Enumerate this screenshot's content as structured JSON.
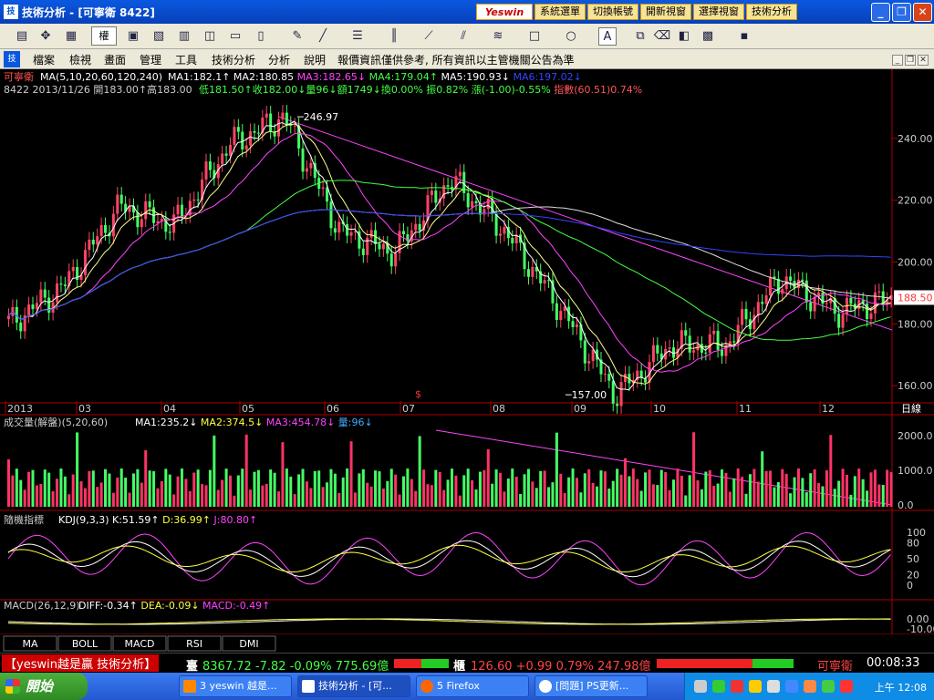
{
  "window": {
    "title": "技術分析 - [可寧衛 8422]",
    "app_icon": "chart-app-icon",
    "top_buttons": [
      "系統選單",
      "切換帳號",
      "開新視窗",
      "選擇視窗",
      "技術分析"
    ],
    "logo": "Yeswin"
  },
  "toolbar": {
    "period_box": "權"
  },
  "menu": {
    "items": [
      "檔案",
      "檢視",
      "畫面",
      "管理",
      "工具",
      "技術分析",
      "分析",
      "說明"
    ],
    "notice": "報價資訊僅供參考, 所有資訊以主管機關公告為準"
  },
  "chart_data": [
    {
      "type": "candlestick",
      "title": "可寧衛",
      "ma_legend": "MA(5,10,20,60,120,240)",
      "ma_values": [
        {
          "label": "MA1:182.1↑",
          "color": "#ffffff"
        },
        {
          "label": "MA2:180.85",
          "color": "#ffffff"
        },
        {
          "label": "MA3:182.65↓",
          "color": "#ff44ff"
        },
        {
          "label": "MA4:179.04↑",
          "color": "#44ff44"
        },
        {
          "label": "MA5:190.93↓",
          "color": "#ffffff"
        },
        {
          "label": "MA6:197.02↓",
          "color": "#3344ff"
        }
      ],
      "info_prefix": "8422 2013/11/26 開183.00↑高183.00",
      "info_items": [
        {
          "label": "低181.50↑收182.00↓量96↓額1749↓換0.00% 振0.82%",
          "color": "#44ff44"
        },
        {
          "label": "漲(-1.00)-0.55%",
          "color": "#44ff44"
        },
        {
          "label": "指數(60.51)0.74%",
          "color": "#ff5555"
        }
      ],
      "y_ticks": [
        240,
        220,
        200,
        180,
        160
      ],
      "ylim": [
        155,
        250
      ],
      "x_labels": [
        "2013",
        "03",
        "04",
        "05",
        "06",
        "07",
        "08",
        "09",
        "10",
        "11",
        "12"
      ],
      "period_label": "日線",
      "high_annotation": "246.97",
      "low_annotation": "157.00",
      "current_price": "188.50",
      "marker": "$",
      "key_points": [
        {
          "month": "01",
          "close": 180
        },
        {
          "month": "02",
          "close": 192
        },
        {
          "month": "03",
          "close": 218
        },
        {
          "month": "04",
          "close": 212
        },
        {
          "month": "04-end",
          "close": 238
        },
        {
          "month": "05",
          "close": 247
        },
        {
          "month": "06",
          "close": 210
        },
        {
          "month": "06-end",
          "close": 203
        },
        {
          "month": "07",
          "close": 227
        },
        {
          "month": "08",
          "close": 210
        },
        {
          "month": "08-mid",
          "close": 185
        },
        {
          "month": "09",
          "close": 157
        },
        {
          "month": "09-end",
          "close": 173
        },
        {
          "month": "10",
          "close": 173
        },
        {
          "month": "11",
          "close": 195
        },
        {
          "month": "11-mid",
          "close": 184
        },
        {
          "month": "12",
          "close": 188
        }
      ]
    },
    {
      "type": "bar",
      "title": "成交量(解盤)(5,20,60)",
      "legend": [
        {
          "label": "MA1:235.2↓",
          "color": "#ffffff"
        },
        {
          "label": "MA2:374.5↓",
          "color": "#ffff44"
        },
        {
          "label": "MA3:454.78↓",
          "color": "#ff44ff"
        },
        {
          "label": "量:96↓",
          "color": "#44aaff"
        }
      ],
      "y_ticks": [
        "2000.0",
        "1000.0",
        "0.0"
      ]
    },
    {
      "type": "line",
      "title": "隨機指標",
      "legend": [
        {
          "label": "KDJ(9,3,3) K:51.59↑",
          "color": "#ffffff"
        },
        {
          "label": "D:36.99↑",
          "color": "#ffff44"
        },
        {
          "label": "J:80.80↑",
          "color": "#ff44ff"
        }
      ],
      "y_ticks": [
        "100",
        "80",
        "50",
        "20",
        "0"
      ]
    },
    {
      "type": "line",
      "title": "MACD(26,12,9)",
      "legend": [
        {
          "label": "DIFF:-0.34↑",
          "color": "#ffffff"
        },
        {
          "label": "DEA:-0.09↓",
          "color": "#ffff44"
        },
        {
          "label": "MACD:-0.49↑",
          "color": "#ff44ff"
        }
      ],
      "y_ticks": [
        "0.00",
        "-10.00"
      ]
    }
  ],
  "indicator_tabs": [
    "MA",
    "BOLL",
    "MACD",
    "RSI",
    "DMI"
  ],
  "status": {
    "brand": "【yeswin越是贏 技術分析】",
    "index1_label": "臺",
    "index1_value": "8367.72 -7.82 -0.09% 775.69億",
    "index2_label": "櫃",
    "index2_value": "126.60 +0.99 0.79% 247.98億",
    "stock": "可寧衛",
    "time": "00:08:33"
  },
  "taskbar": {
    "start": "開始",
    "tasks": [
      "3 yeswin 越是...",
      "技術分析 - [可...",
      "5 Firefox",
      "[問題] PS更新..."
    ],
    "clock": "上午 12:08"
  }
}
